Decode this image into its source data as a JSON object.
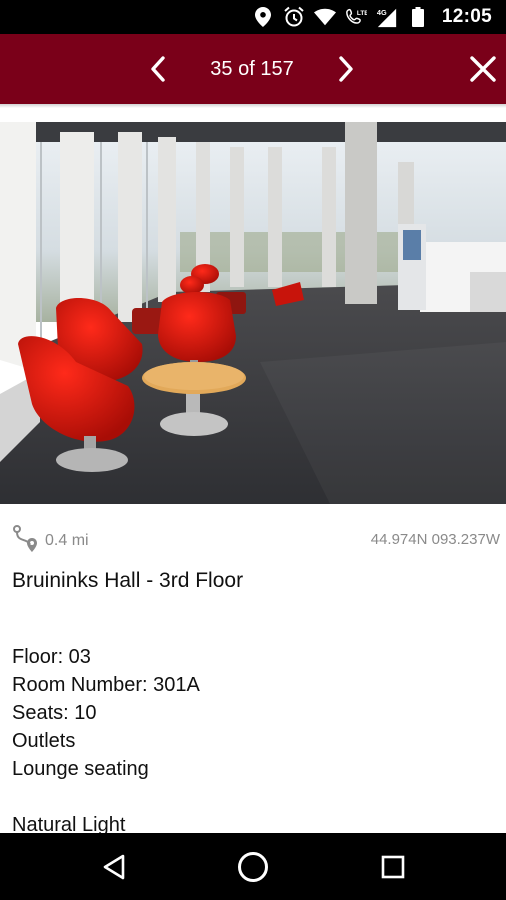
{
  "status_bar": {
    "time": "12:05",
    "icons": [
      "location-icon",
      "alarm-icon",
      "wifi-icon",
      "volte-call-icon",
      "signal-4g-icon",
      "battery-icon"
    ]
  },
  "header": {
    "counter": "35 of 157",
    "icons": {
      "prev": "chevron-left-icon",
      "next": "chevron-right-icon",
      "close": "close-icon"
    },
    "background": "#7a0019"
  },
  "photo": {
    "subject": "lounge-photo"
  },
  "info": {
    "distance": "0.4 mi",
    "coordinates": "44.974N 093.237W",
    "title": "Bruininks Hall - 3rd Floor",
    "details": [
      "Floor: 03",
      "Room Number: 301A",
      "Seats: 10",
      "Outlets",
      "Lounge seating",
      "",
      "Natural Light"
    ]
  },
  "nav_bar": {
    "icons": {
      "back": "back-triangle-icon",
      "home": "home-circle-icon",
      "recents": "recents-square-icon"
    }
  }
}
